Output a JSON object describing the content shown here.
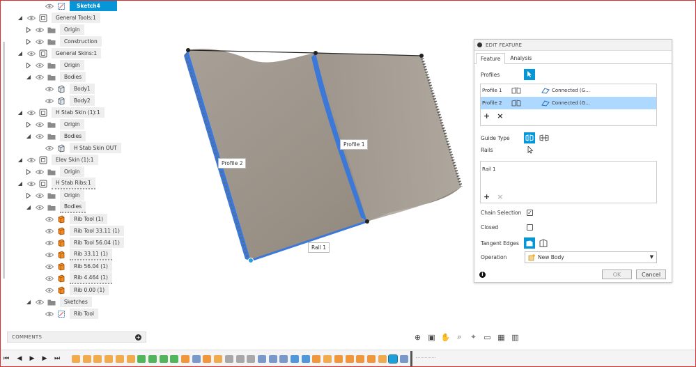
{
  "browser": {
    "items": [
      {
        "label": "Sketch4",
        "depth": 3,
        "arrow": "",
        "icon": "sketch",
        "selected": true
      },
      {
        "label": "General Tools:1",
        "depth": 1,
        "arrow": "down",
        "icon": "component"
      },
      {
        "label": "Origin",
        "depth": 2,
        "arrow": "right",
        "icon": "folder"
      },
      {
        "label": "Construction",
        "depth": 2,
        "arrow": "right",
        "icon": "folder"
      },
      {
        "label": "General Skins:1",
        "depth": 1,
        "arrow": "down",
        "icon": "component"
      },
      {
        "label": "Origin",
        "depth": 2,
        "arrow": "right",
        "icon": "folder"
      },
      {
        "label": "Bodies",
        "depth": 2,
        "arrow": "down",
        "icon": "folder"
      },
      {
        "label": "Body1",
        "depth": 3,
        "arrow": "",
        "icon": "body"
      },
      {
        "label": "Body2",
        "depth": 3,
        "arrow": "",
        "icon": "body"
      },
      {
        "label": "H Stab Skin (1):1",
        "depth": 1,
        "arrow": "down",
        "icon": "component"
      },
      {
        "label": "Origin",
        "depth": 2,
        "arrow": "right",
        "icon": "folder"
      },
      {
        "label": "Bodies",
        "depth": 2,
        "arrow": "down",
        "icon": "folder"
      },
      {
        "label": "H Stab Skin OUT",
        "depth": 3,
        "arrow": "",
        "icon": "body"
      },
      {
        "label": "Elev Skin (1):1",
        "depth": 1,
        "arrow": "down",
        "icon": "component"
      },
      {
        "label": "Origin",
        "depth": 2,
        "arrow": "right",
        "icon": "folder"
      },
      {
        "label": "H Stab Ribs:1",
        "depth": 1,
        "arrow": "down",
        "icon": "component",
        "squiggle": true
      },
      {
        "label": "Origin",
        "depth": 2,
        "arrow": "right",
        "icon": "folder"
      },
      {
        "label": "Bodies",
        "depth": 2,
        "arrow": "down",
        "icon": "folder",
        "squiggle": true
      },
      {
        "label": "Rib Tool (1)",
        "depth": 3,
        "arrow": "",
        "icon": "body-orange"
      },
      {
        "label": "Rib  Tool 33.11 (1)",
        "depth": 3,
        "arrow": "",
        "icon": "body-orange"
      },
      {
        "label": "Rib Tool 56.04 (1)",
        "depth": 3,
        "arrow": "",
        "icon": "body-orange"
      },
      {
        "label": "Rib 33.11 (1)",
        "depth": 3,
        "arrow": "",
        "icon": "body-orange",
        "squiggle": true
      },
      {
        "label": "Rib 56.04 (1)",
        "depth": 3,
        "arrow": "",
        "icon": "body-orange"
      },
      {
        "label": "Rib 4.464 (1)",
        "depth": 3,
        "arrow": "",
        "icon": "body-orange",
        "squiggle": true
      },
      {
        "label": "Rib 0.00 (1)",
        "depth": 3,
        "arrow": "",
        "icon": "body-orange"
      },
      {
        "label": "Sketches",
        "depth": 2,
        "arrow": "down",
        "icon": "folder"
      },
      {
        "label": "Rib Tool",
        "depth": 3,
        "arrow": "",
        "icon": "sketch"
      }
    ]
  },
  "comments": {
    "label": "COMMENTS"
  },
  "canvas": {
    "profile1_label": "Profile 1",
    "profile2_label": "Profile 2",
    "rail1_label": "Rail 1"
  },
  "panel": {
    "title": "EDIT FEATURE",
    "tabs": [
      "Feature",
      "Analysis"
    ],
    "profiles_label": "Profiles",
    "profiles": [
      {
        "name": "Profile 1",
        "status": "Connected (G..."
      },
      {
        "name": "Profile 2",
        "status": "Connected (G..."
      }
    ],
    "guide_type_label": "Guide Type",
    "rails_label": "Rails",
    "rails": [
      "Rail 1"
    ],
    "chain_selection_label": "Chain Selection",
    "chain_selection_checked": true,
    "closed_label": "Closed",
    "closed_checked": false,
    "tangent_edges_label": "Tangent Edges",
    "operation_label": "Operation",
    "operation_value": "New Body",
    "ok_label": "OK",
    "cancel_label": "Cancel",
    "add_symbol": "+",
    "remove_symbol": "×",
    "check_symbol": "✓",
    "info_symbol": "i"
  },
  "colors": {
    "accent": "#0696d7",
    "selection": "#add8ff",
    "surface": "#9a9187",
    "edge_highlight": "#3b78d8"
  }
}
